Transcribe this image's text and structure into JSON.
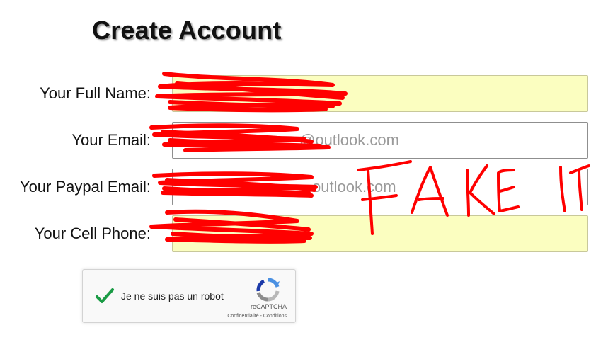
{
  "page": {
    "title": "Create Account"
  },
  "form": {
    "full_name": {
      "label": "Your Full Name:",
      "value": "",
      "autofilled": true
    },
    "email": {
      "label": "Your Email:",
      "value": "@outlook.com"
    },
    "paypal_email": {
      "label": "Your Paypal Email:",
      "value": "outlook.com"
    },
    "cell_phone": {
      "label": "Your Cell Phone:",
      "value": "",
      "autofilled": true
    }
  },
  "annotation": {
    "handwritten_text": "FAKE IT",
    "color": "#ff0000"
  },
  "captcha": {
    "label": "Je ne suis pas un robot",
    "checked": true,
    "brand": "reCAPTCHA",
    "privacy_link": "Confidentialité",
    "separator": " - ",
    "terms_link": "Conditions",
    "check_color": "#1a9b45"
  },
  "colors": {
    "autofill_background": "#fbfec0",
    "redaction": "#ff0000"
  }
}
